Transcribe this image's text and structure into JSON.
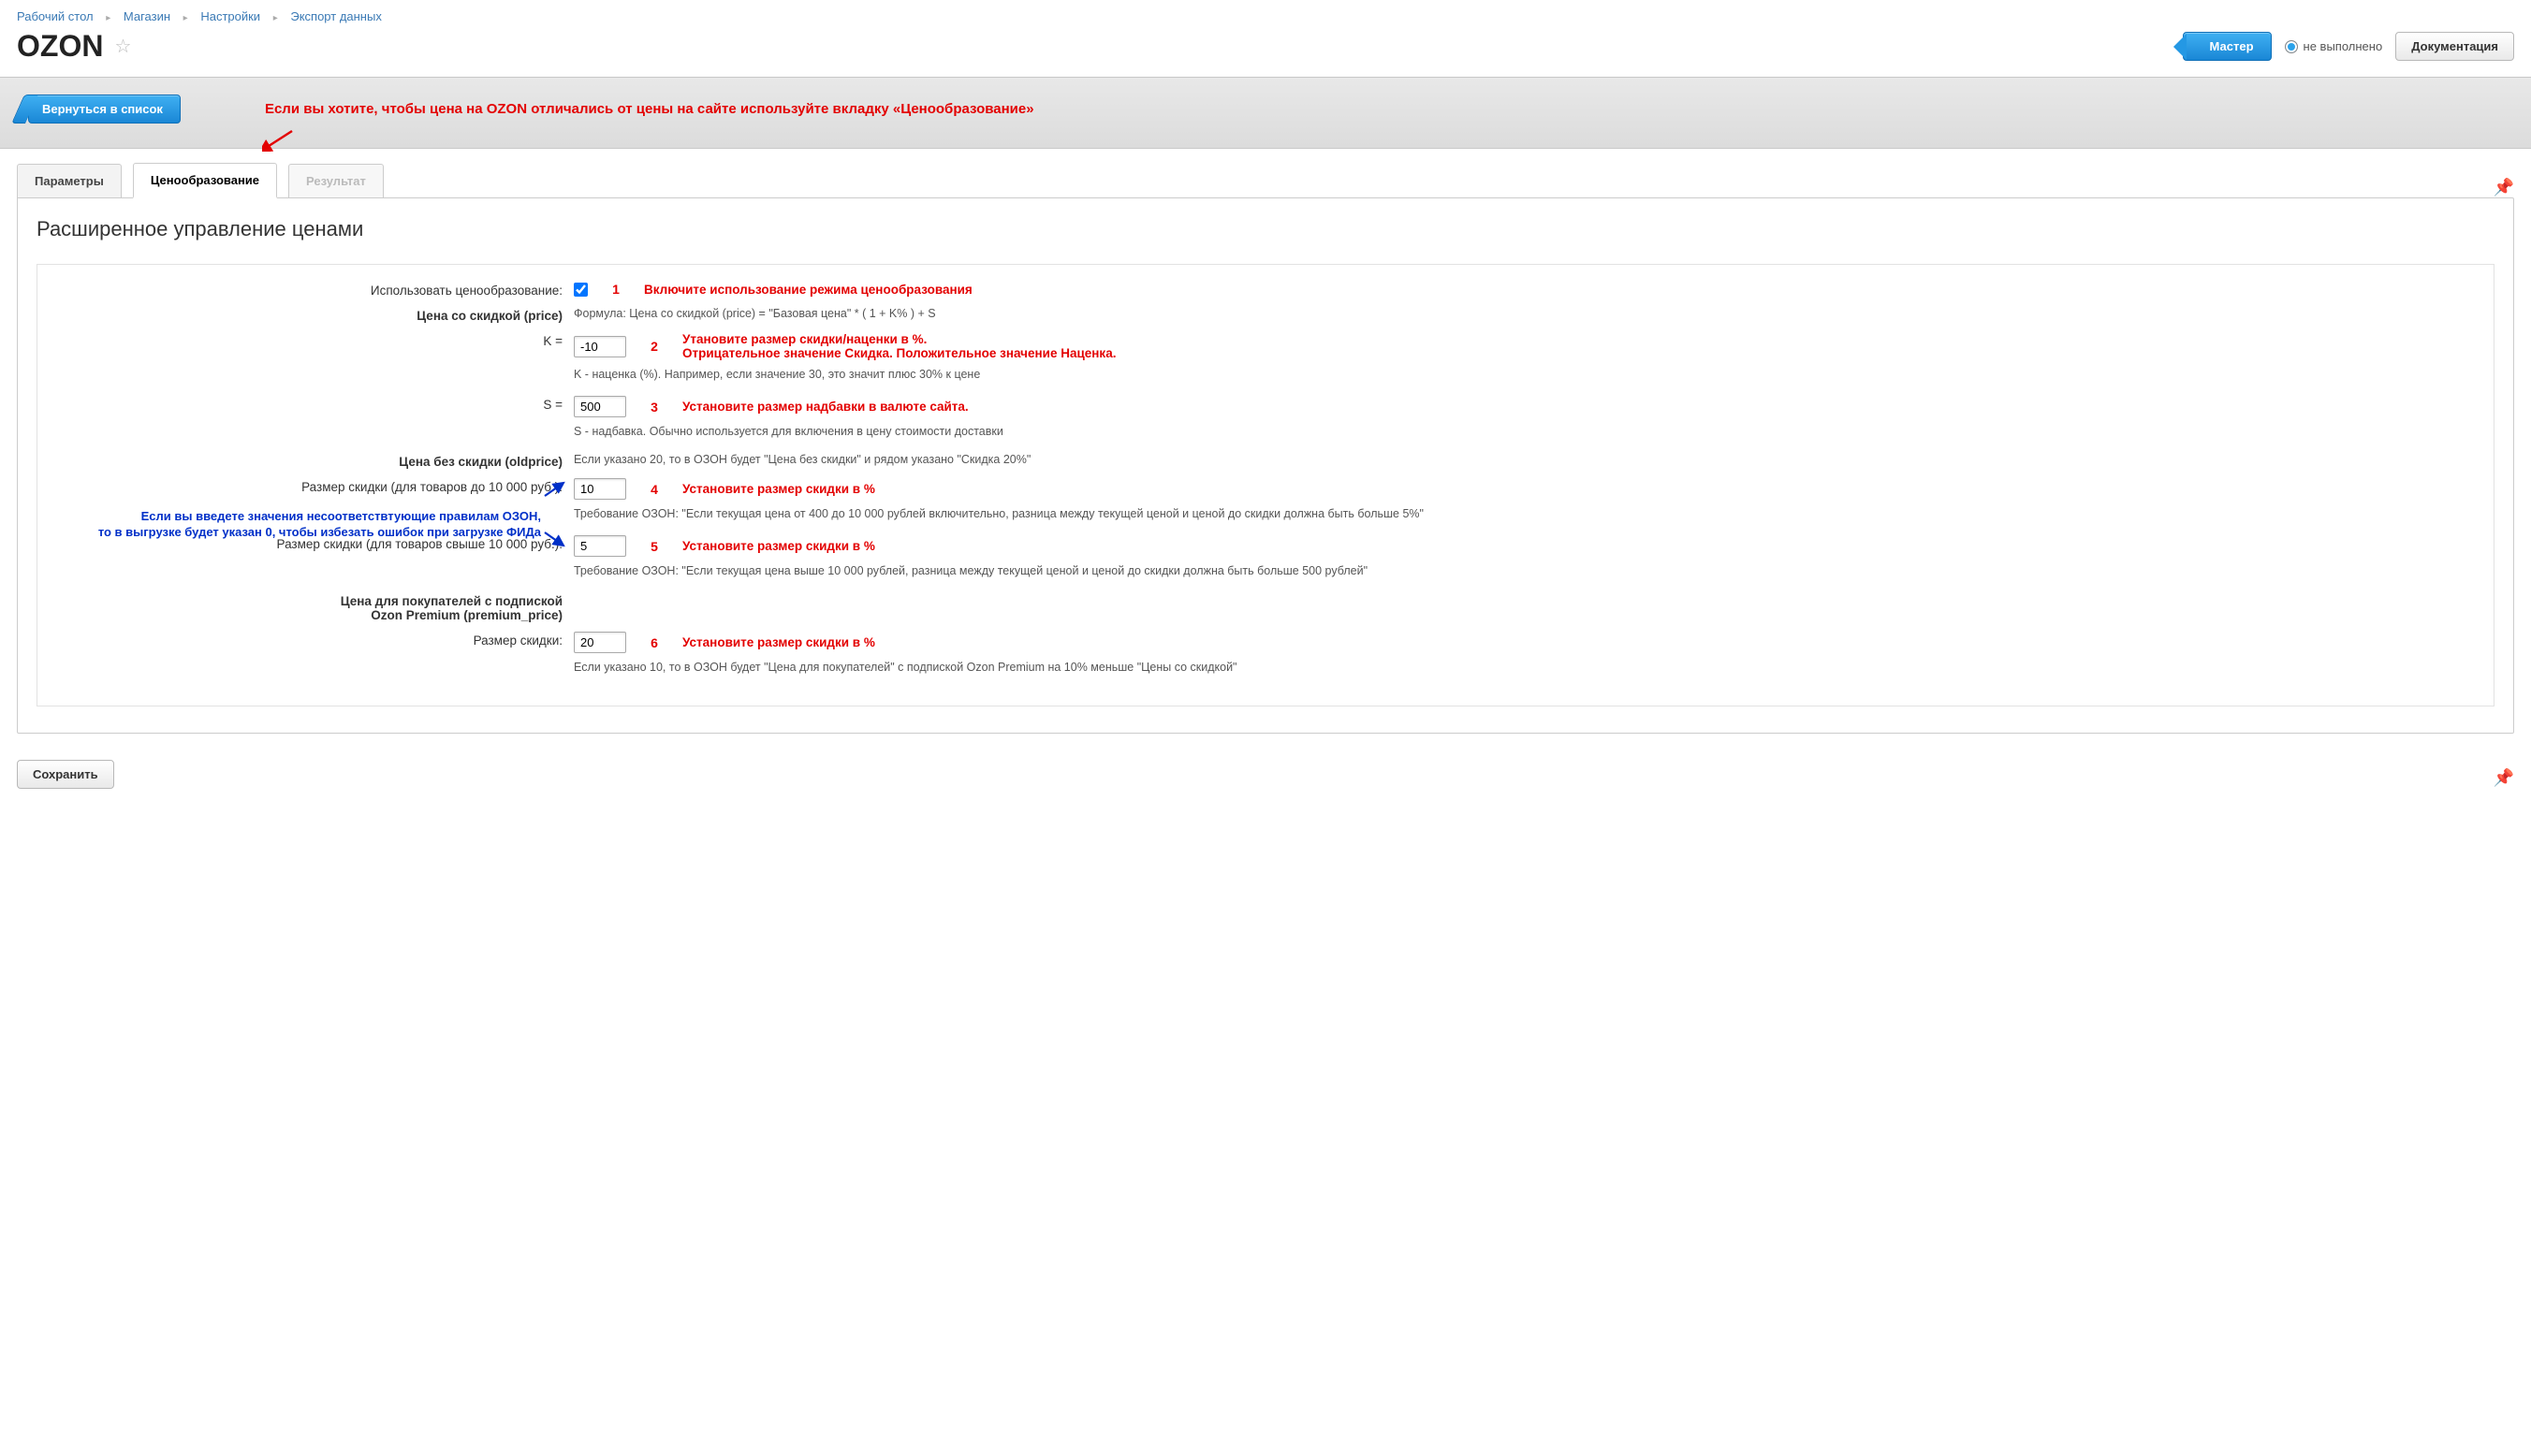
{
  "breadcrumb": {
    "items": [
      "Рабочий стол",
      "Магазин",
      "Настройки",
      "Экспорт данных"
    ]
  },
  "header": {
    "title": "OZON",
    "master_btn": "Мастер",
    "status_text": "не выполнено",
    "doc_btn": "Документация"
  },
  "graybox": {
    "back_btn": "Вернуться в список",
    "banner": "Если вы хотите, чтобы цена на OZON отличались от цены на сайте используйте вкладку «Ценообразование»"
  },
  "tabs": {
    "t0": "Параметры",
    "t1": "Ценообразование",
    "t2": "Результат"
  },
  "panel": {
    "title": "Расширенное управление ценами"
  },
  "form": {
    "use_pricing_label": "Использовать ценообразование:",
    "note1": "Включите использование режима ценообразования",
    "price_section": "Цена со скидкой (price)",
    "formula": "Формула: Цена со скидкой (price) = \"Базовая цена\" * ( 1 + K% ) + S",
    "k_label": "K =",
    "k_value": "-10",
    "note2_a": "Утановите размер скидки/наценки в %.",
    "note2_b": "Отрицательное значение Скидка. Положительное значение Наценка.",
    "k_help": "K - наценка (%). Например, если значение 30, это значит плюс 30% к цене",
    "s_label": "S =",
    "s_value": "500",
    "note3": "Установите размер надбавки в валюте сайта.",
    "s_help": "S - надбавка. Обычно используется для включения в цену стоимости доставки",
    "oldprice_section": "Цена без скидки (oldprice)",
    "oldprice_help": "Если указано 20, то в ОЗОН будет \"Цена без скидки\" и рядом указано \"Скидка 20%\"",
    "disc1_label": "Размер скидки (для товаров до 10 000 руб.):",
    "disc1_value": "10",
    "note4": "Установите размер скидки в %",
    "disc1_help": "Требование ОЗОН: \"Если текущая цена от 400 до 10 000 рублей включительно, разница между текущей ценой и ценой до скидки должна быть больше 5%\"",
    "disc2_label": "Размер скидки (для товаров свыше 10 000 руб.):",
    "disc2_value": "5",
    "note5": "Установите размер скидки в %",
    "disc2_help": "Требование ОЗОН: \"Если текущая цена выше 10 000 рублей, разница между текущей ценой и ценой до скидки должна быть больше 500 рублей\"",
    "premium_section_a": "Цена для покупателей с подпиской",
    "premium_section_b": "Ozon Premium (premium_price)",
    "disc3_label": "Размер скидки:",
    "disc3_value": "20",
    "note6": "Установите размер скидки в %",
    "disc3_help": "Если указано 10, то в ОЗОН будет \"Цена для покупателей\" с подпиской Ozon Premium на 10% меньше \"Цены со скидкой\"",
    "blue_note_a": "Если вы введете значения несоответствтующие правилам ОЗОН,",
    "blue_note_b": "то в выгрузке будет указан 0, чтобы избезать ошибок при загрузке ФИДа"
  },
  "footer": {
    "save_btn": "Сохранить"
  },
  "nums": {
    "n1": "1",
    "n2": "2",
    "n3": "3",
    "n4": "4",
    "n5": "5",
    "n6": "6"
  }
}
